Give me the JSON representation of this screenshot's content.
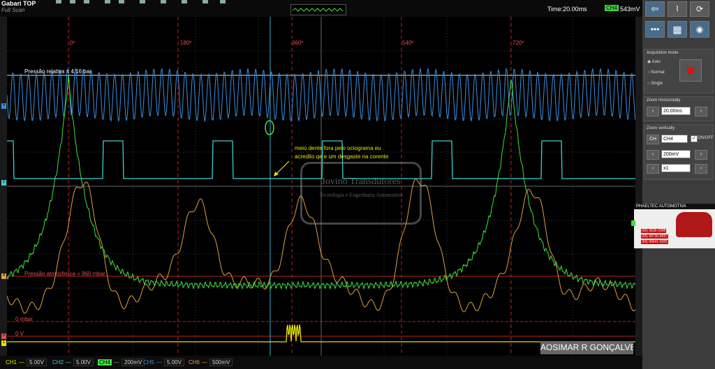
{
  "brand": {
    "line1": "Gabari TOP",
    "line2": "Full Scan"
  },
  "header": {
    "time_label": "Time:20.00ms",
    "ch_badge": "CH4",
    "ch_value": "543mV"
  },
  "markers": {
    "angles": [
      "0º",
      "180º",
      "360º",
      "540º",
      "720º"
    ]
  },
  "annotations": {
    "pressure_relative": "Pressão relativa = 4,16 bar",
    "pressure_atmospheric": "Pressão atmosferica = 960 mbar",
    "zero_mbar": "0 mbar",
    "zero_v": "0 V",
    "note_line1": "meio dente fora pelo ociograma eu",
    "note_line2": "acredito qe e um desgaste na corente",
    "watermark_line1": "Jovino Transdutores",
    "watermark_line2": "Tecnologia e Engenharia Automotiva",
    "signature": "AOSIMAR R GONÇALVES"
  },
  "channels": [
    {
      "name": "CH1",
      "value": "5.00V",
      "color": "#e6e600"
    },
    {
      "name": "CH2",
      "value": "5.00V",
      "color": "#40d0d0"
    },
    {
      "name": "CH4",
      "value": "200mV",
      "color": "#40e040"
    },
    {
      "name": "CH5",
      "value": "5.00V",
      "color": "#3b8fe0"
    },
    {
      "name": "CH6",
      "value": "500mV",
      "color": "#e0a040"
    }
  ],
  "left_markers": [
    "5",
    "2",
    "4",
    "0",
    "1"
  ],
  "right_panel": {
    "acq_title": "Acquisition mode",
    "acq_options": [
      "Auto",
      "Normal",
      "Single"
    ],
    "acq_selected": "Auto",
    "zoom_h_title": "Zoom Horizontally",
    "zoom_h_value": "20.00ms",
    "zoom_v_title": "Zoom vertically",
    "zoom_v_ch_btn": "CH",
    "zoom_v_channel": "CH4",
    "onoff_label": "ON/OFF",
    "zoom_v_value": "200mV",
    "zoom_v_mult": "x1",
    "ad_title": "PHAELTEC AUTOMOTIVA",
    "ad_phones": [
      "(66) 3539-2308",
      "(66) 99730-8697",
      "(66) 99641-6265"
    ]
  },
  "colors": {
    "ch4_green": "#40e040",
    "ch5_blue": "#3b8fe0",
    "ch2_cyan": "#40d0d0",
    "ch6_orange": "#e0a040",
    "ch1_yellow": "#e6e600",
    "marker_red": "#c02020",
    "record_red": "#e01010"
  }
}
